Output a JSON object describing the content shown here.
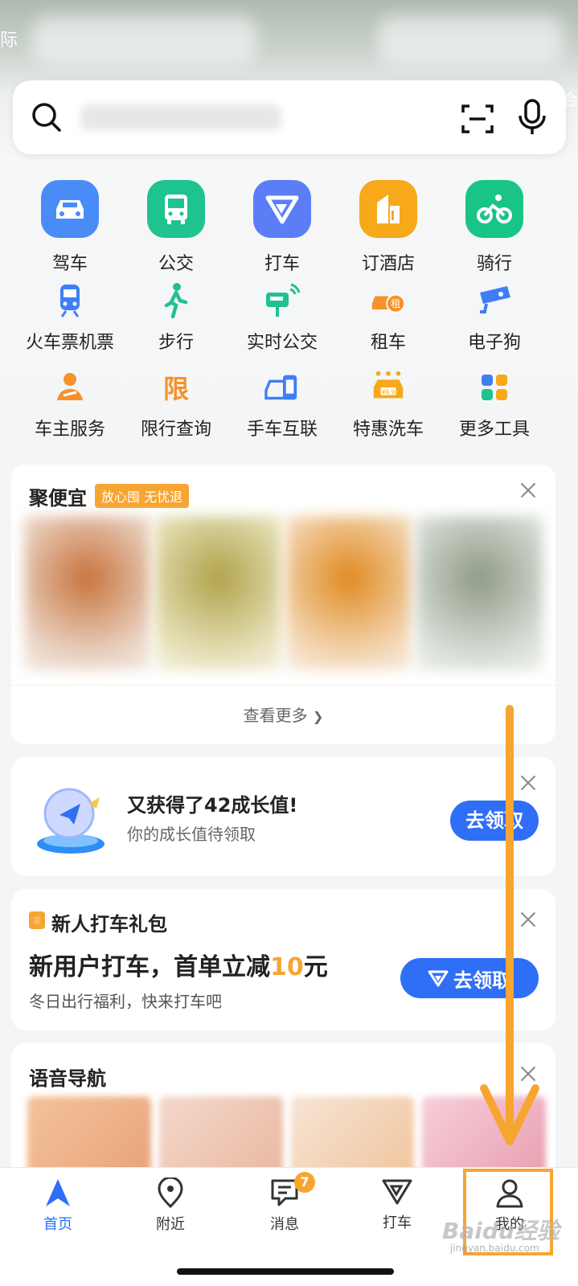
{
  "map": {
    "corner_left": "际",
    "corner_right": "合"
  },
  "search": {
    "placeholder": ""
  },
  "primary_tools": [
    {
      "label": "驾车",
      "icon": "car-icon",
      "color": "#4a8cf7"
    },
    {
      "label": "公交",
      "icon": "bus-icon",
      "color": "#1ec38f"
    },
    {
      "label": "打车",
      "icon": "taxi-icon",
      "color": "#5b7ef7"
    },
    {
      "label": "订酒店",
      "icon": "hotel-icon",
      "color": "#f7a91a"
    },
    {
      "label": "骑行",
      "icon": "bike-icon",
      "color": "#19c487"
    }
  ],
  "secondary_tools_row1": [
    {
      "label": "火车票机票",
      "icon": "train-icon"
    },
    {
      "label": "步行",
      "icon": "walk-icon"
    },
    {
      "label": "实时公交",
      "icon": "realtime-bus-icon"
    },
    {
      "label": "租车",
      "icon": "rent-car-icon",
      "badge": "租"
    },
    {
      "label": "电子狗",
      "icon": "camera-icon"
    }
  ],
  "secondary_tools_row2": [
    {
      "label": "车主服务",
      "icon": "driver-service-icon"
    },
    {
      "label": "限行查询",
      "icon": "restriction-icon",
      "glyph": "限"
    },
    {
      "label": "手车互联",
      "icon": "phone-car-icon"
    },
    {
      "label": "特惠洗车",
      "icon": "car-wash-icon",
      "badge": "¥9.9"
    },
    {
      "label": "更多工具",
      "icon": "more-tools-icon"
    }
  ],
  "jupianyi": {
    "title": "聚便宜",
    "badge": "放心囤 无忧退",
    "more": "查看更多",
    "more_arrow": "❯"
  },
  "growth": {
    "title": "又获得了42成长值!",
    "subtitle": "你的成长值待领取",
    "button": "去领取"
  },
  "new_ride": {
    "title": "新人打车礼包",
    "main_prefix": "新用户打车，首单立减",
    "main_amount": "10",
    "main_suffix": "元",
    "subtitle": "冬日出行福利，快来打车吧",
    "button": "去领取"
  },
  "voice_nav": {
    "title": "语音导航"
  },
  "tabs": [
    {
      "label": "首页",
      "icon": "home-nav-icon",
      "active": true
    },
    {
      "label": "附近",
      "icon": "location-pin-icon",
      "active": false
    },
    {
      "label": "消息",
      "icon": "message-icon",
      "active": false,
      "badge": "7"
    },
    {
      "label": "打车",
      "icon": "taxi-tab-icon",
      "active": false
    },
    {
      "label": "我的",
      "icon": "user-icon",
      "active": false
    }
  ],
  "watermark": {
    "text": "Baidu经验",
    "sub": "jingyan.baidu.com"
  },
  "colors": {
    "accent": "#2f6ef6",
    "orange": "#f7a531"
  }
}
